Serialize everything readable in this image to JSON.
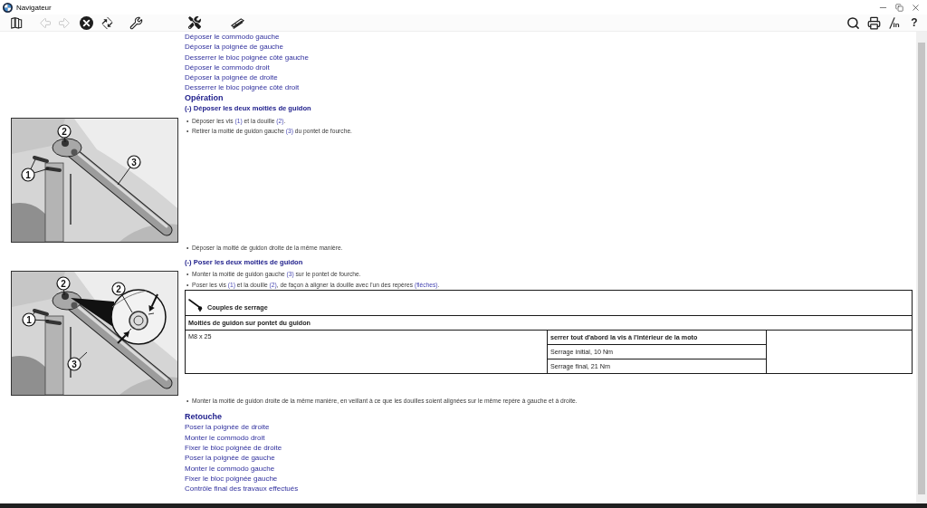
{
  "window": {
    "title": "Navigateur"
  },
  "toolbar": {
    "left": [
      {
        "kind": "books",
        "disabled": false
      },
      {
        "kind": "back",
        "disabled": true
      },
      {
        "kind": "forward",
        "disabled": true
      },
      {
        "kind": "cancel",
        "disabled": false
      },
      {
        "kind": "swap",
        "disabled": false
      },
      {
        "kind": "wrench",
        "disabled": false
      }
    ],
    "tools": [
      {
        "kind": "tools",
        "disabled": false
      },
      {
        "kind": "gauge",
        "disabled": false
      }
    ],
    "right": [
      {
        "kind": "search",
        "disabled": false
      },
      {
        "kind": "print",
        "disabled": false
      },
      {
        "kind": "units",
        "label": "in",
        "disabled": false
      },
      {
        "kind": "help",
        "label": "?",
        "disabled": false
      }
    ]
  },
  "document": {
    "blocks": [
      {
        "kind": "link",
        "text": "Déposer le commodo gauche"
      },
      {
        "kind": "link",
        "text": "Déposer la poignée de gauche"
      },
      {
        "kind": "link",
        "text": "Desserrer le bloc poignée côté gauche"
      },
      {
        "kind": "link",
        "text": "Déposer le commodo droit"
      },
      {
        "kind": "link",
        "text": "Déposer la poignée de droite"
      },
      {
        "kind": "link",
        "text": "Desserrer le bloc poignée côté droit"
      },
      {
        "kind": "heading",
        "text": "Opération"
      },
      {
        "kind": "subheading",
        "text": "(-) Déposer les deux moitiés de guidon"
      },
      {
        "kind": "step",
        "figure": {
          "kind": "remove",
          "callouts": [
            {
              "label": "2"
            },
            {
              "label": "1"
            },
            {
              "label": "3"
            }
          ]
        },
        "bullets": [
          {
            "marker": "•",
            "parts": [
              {
                "kind": "text",
                "text": "Déposer les vis "
              },
              {
                "kind": "ref",
                "text": "(1)"
              },
              {
                "kind": "text",
                "text": " et la douille "
              },
              {
                "kind": "ref",
                "text": "(2)"
              },
              {
                "kind": "text",
                "text": "."
              }
            ]
          },
          {
            "marker": "•",
            "parts": [
              {
                "kind": "text",
                "text": "Retirer la moitié de guidon gauche "
              },
              {
                "kind": "ref",
                "text": "(3)"
              },
              {
                "kind": "text",
                "text": " du pontet de fourche."
              }
            ]
          }
        ]
      },
      {
        "kind": "step",
        "bullets": [
          {
            "marker": "•",
            "parts": [
              {
                "kind": "text",
                "text": "Déposer la moitié de guidon droite de la même manière."
              }
            ]
          }
        ]
      },
      {
        "kind": "subheading",
        "text": "(-) Poser les deux moitiés de guidon"
      },
      {
        "kind": "step",
        "figure": {
          "kind": "install",
          "callouts": [
            {
              "label": "2"
            },
            {
              "label": "1"
            },
            {
              "label": "3"
            },
            {
              "label": "2"
            }
          ]
        },
        "bullets": [
          {
            "marker": "•",
            "parts": [
              {
                "kind": "text",
                "text": "Monter la moitié de guidon gauche "
              },
              {
                "kind": "ref",
                "text": "(3)"
              },
              {
                "kind": "text",
                "text": " sur le pontet de fourche."
              }
            ]
          },
          {
            "marker": "•",
            "parts": [
              {
                "kind": "text",
                "text": "Poser les vis "
              },
              {
                "kind": "ref",
                "text": "(1)"
              },
              {
                "kind": "text",
                "text": " et la douille "
              },
              {
                "kind": "ref",
                "text": "(2)"
              },
              {
                "kind": "text",
                "text": ", de façon à aligner la douille avec l'un des repères "
              },
              {
                "kind": "ref",
                "text": "(flèches)"
              },
              {
                "kind": "text",
                "text": "."
              }
            ]
          }
        ],
        "table": {
          "title": "Couples de serrage",
          "group": "Moitiés de guidon sur pontet du guidon",
          "rows": [
            {
              "part": "M8 x 25",
              "notes": [
                {
                  "text": "serrer tout d'abord la vis à l'intérieur de la moto",
                  "bold": true
                },
                {
                  "text": "Serrage initial, 10 Nm",
                  "bold": false
                },
                {
                  "text": "Serrage final, 21 Nm",
                  "bold": false
                }
              ]
            }
          ]
        }
      },
      {
        "kind": "step",
        "bullets": [
          {
            "marker": "•",
            "parts": [
              {
                "kind": "text",
                "text": "Monter la moitié de guidon droite de la même manière, en veillant à ce que les douilles soient alignées sur le même repère à gauche et à droite."
              }
            ]
          }
        ]
      },
      {
        "kind": "heading",
        "text": "Retouche"
      },
      {
        "kind": "link",
        "text": "Poser la poignée de droite"
      },
      {
        "kind": "link",
        "text": "Monter le commodo droit"
      },
      {
        "kind": "link",
        "text": "Fixer le bloc poignée de droite"
      },
      {
        "kind": "link",
        "text": "Poser la poignée de gauche"
      },
      {
        "kind": "link",
        "text": "Monter le commodo gauche"
      },
      {
        "kind": "link",
        "text": "Fixer le bloc poignée gauche"
      },
      {
        "kind": "link",
        "text": "Contrôle final des travaux effectués"
      }
    ]
  }
}
